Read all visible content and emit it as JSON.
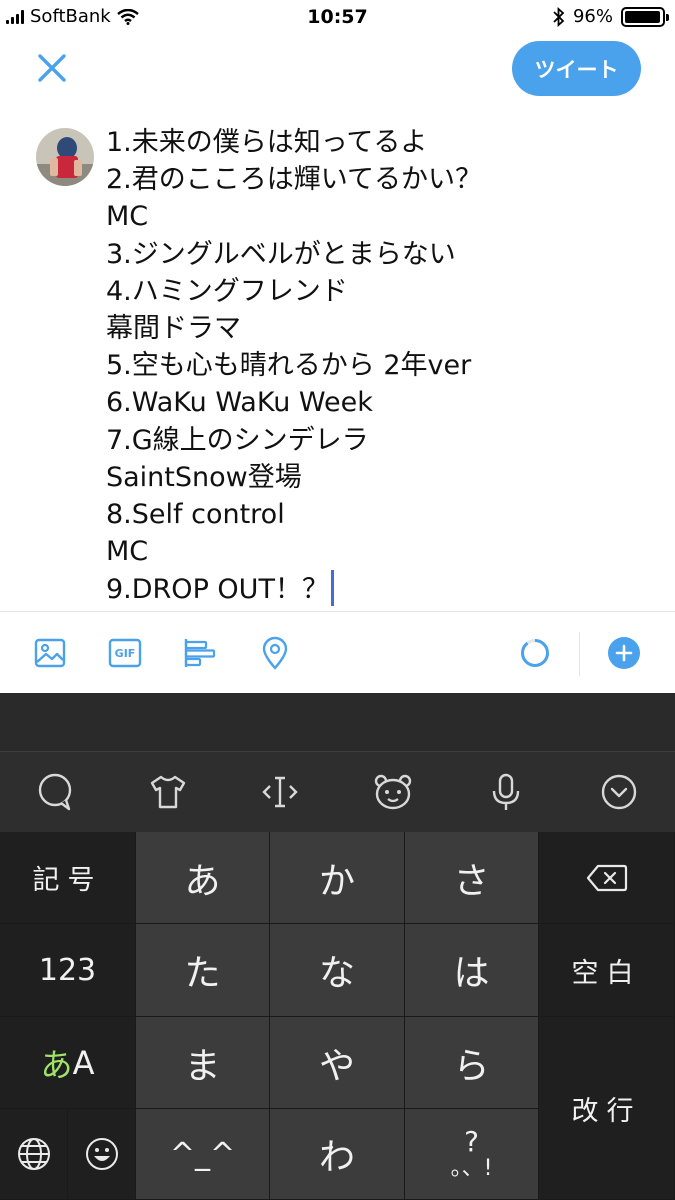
{
  "status_bar": {
    "carrier": "SoftBank",
    "time": "10:57",
    "battery_percent_label": "96%",
    "battery_level": 0.96
  },
  "header": {
    "close_icon": "close-icon",
    "tweet_button_label": "ツイート"
  },
  "composer": {
    "lines": [
      "1.未来の僕らは知ってるよ",
      "2.君のこころは輝いてるかい？",
      "MC",
      "3.ジングルベルがとまらない",
      "4.ハミングフレンド",
      "幕間ドラマ",
      "5.空も心も晴れるから 2年ver",
      "6.WaKu WaKu Week",
      "7.G線上のシンデレラ",
      "SaintSnow登場",
      "8.Self control",
      "MC",
      "9.DROP OUT！？"
    ]
  },
  "compose_toolbar": {
    "icons": [
      "image-icon",
      "gif-icon",
      "poll-icon",
      "location-icon",
      "character-count-ring",
      "add-tweet-icon"
    ],
    "gif_label": "GIF",
    "accent": "#4aa1ec"
  },
  "keyboard": {
    "toolbar_icons": [
      "speech-bubble-icon",
      "tshirt-icon",
      "cursor-move-icon",
      "bear-face-icon",
      "microphone-icon",
      "collapse-icon"
    ],
    "keys": {
      "symbols": "記号",
      "a": "あ",
      "ka": "か",
      "sa": "さ",
      "numbers": "123",
      "ta": "た",
      "na": "な",
      "ha": "は",
      "space": "空白",
      "mode_kana": "あ",
      "mode_alpha": "A",
      "ma": "ま",
      "ya": "や",
      "ra": "ら",
      "return": "改行",
      "kaomoji": "^_^",
      "wa": "わ",
      "punct_top": "?",
      "punct_bottom": "。、!"
    }
  }
}
